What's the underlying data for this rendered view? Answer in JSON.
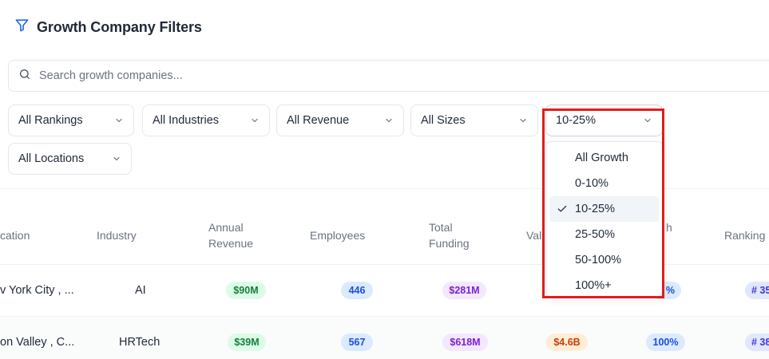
{
  "header": {
    "title": "Growth Company Filters",
    "icon": "filter-icon"
  },
  "search": {
    "placeholder": "Search growth companies...",
    "value": ""
  },
  "filters": {
    "rankings": "All Rankings",
    "industries": "All Industries",
    "revenue": "All Revenue",
    "sizes": "All Sizes",
    "growth": "10-25%",
    "locations": "All Locations"
  },
  "growth_dropdown": {
    "options": [
      "All Growth",
      "0-10%",
      "10-25%",
      "25-50%",
      "50-100%",
      "100%+"
    ],
    "selected": "10-25%"
  },
  "table": {
    "headers": {
      "location": "cation",
      "industry": "Industry",
      "revenue_1": "Annual",
      "revenue_2": "Revenue",
      "employees": "Employees",
      "funding_1": "Total",
      "funding_2": "Funding",
      "valuation": "Val",
      "growth": "h",
      "ranking": "Ranking"
    },
    "rows": [
      {
        "location": "v York City , ...",
        "industry": "AI",
        "revenue": "$90M",
        "employees": "446",
        "funding": "$281M",
        "valuation": "",
        "growth": "%",
        "ranking": "# 35"
      },
      {
        "location": "on Valley , C...",
        "industry": "HRTech",
        "revenue": "$39M",
        "employees": "567",
        "funding": "$618M",
        "valuation": "$4.6B",
        "growth": "100%",
        "ranking": "# 38"
      }
    ]
  },
  "colors": {
    "accent": "#2563eb",
    "highlight": "#e11d1d"
  }
}
